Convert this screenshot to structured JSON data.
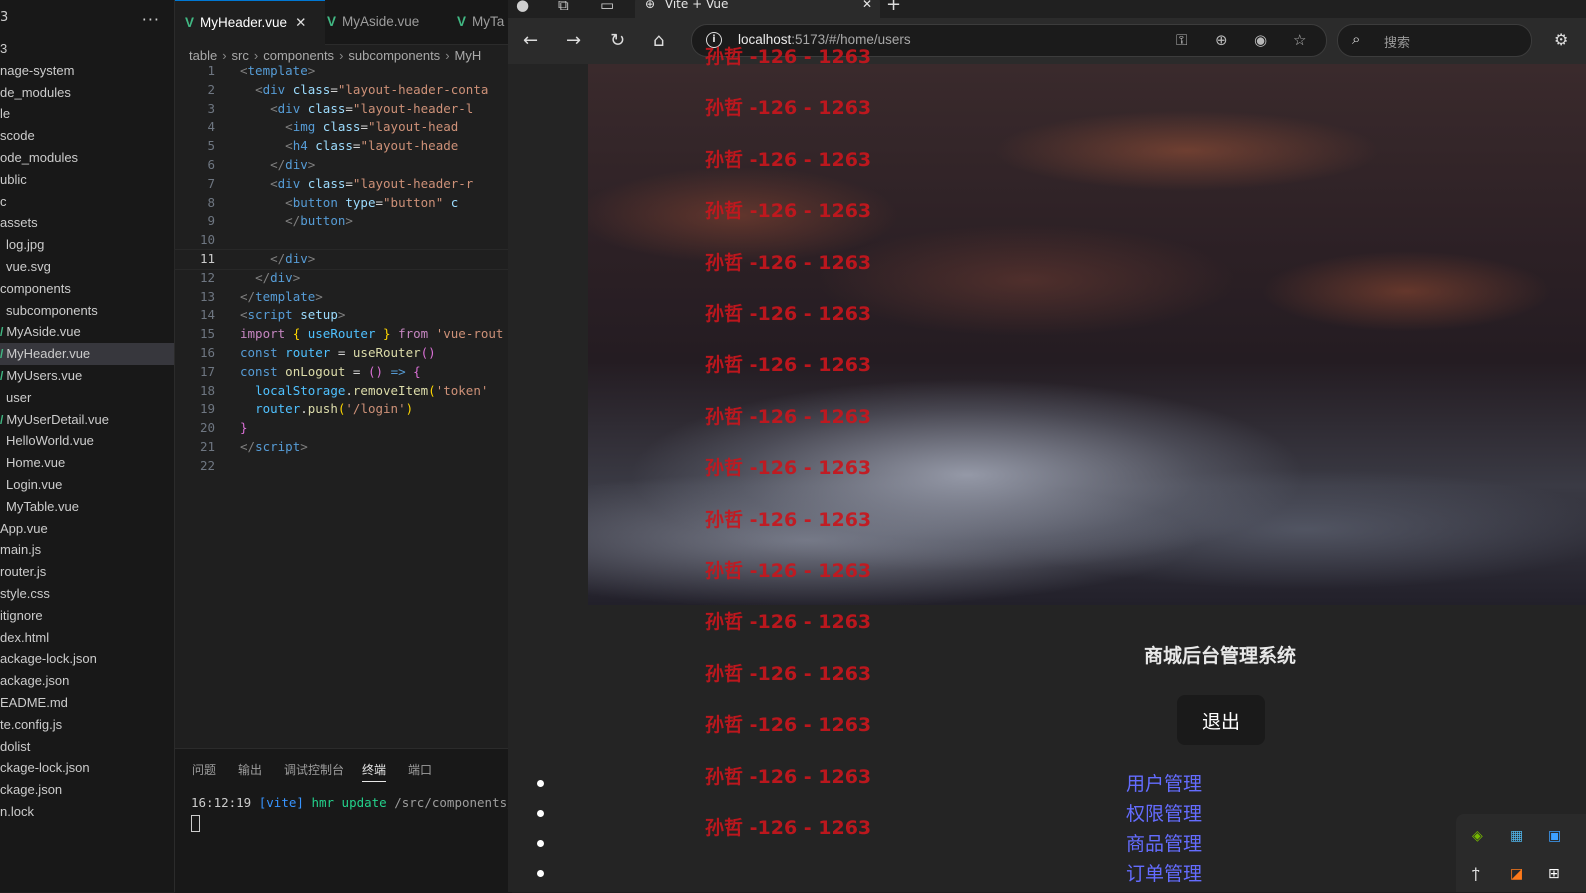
{
  "vscode": {
    "explorer": {
      "more_label": "···",
      "top_mark": "3",
      "items": [
        {
          "label": "3",
          "vue": false,
          "indent": 0
        },
        {
          "label": "nage-system",
          "vue": false,
          "indent": 0
        },
        {
          "label": "de_modules",
          "vue": false,
          "indent": 0
        },
        {
          "label": "le",
          "vue": false,
          "indent": 0
        },
        {
          "label": "scode",
          "vue": false,
          "indent": 0
        },
        {
          "label": "ode_modules",
          "vue": false,
          "indent": 0
        },
        {
          "label": "ublic",
          "vue": false,
          "indent": 0
        },
        {
          "label": "c",
          "vue": false,
          "indent": 0
        },
        {
          "label": "assets",
          "vue": false,
          "indent": 0
        },
        {
          "label": "log.jpg",
          "vue": false,
          "indent": 6
        },
        {
          "label": "vue.svg",
          "vue": false,
          "indent": 6
        },
        {
          "label": "components",
          "vue": false,
          "indent": 0
        },
        {
          "label": "subcomponents",
          "vue": false,
          "indent": 6
        },
        {
          "label": "MyAside.vue",
          "vue": true,
          "indent": 0
        },
        {
          "label": "MyHeader.vue",
          "vue": true,
          "indent": 0,
          "selected": true
        },
        {
          "label": "MyUsers.vue",
          "vue": true,
          "indent": 0
        },
        {
          "label": "user",
          "vue": false,
          "indent": 6
        },
        {
          "label": "MyUserDetail.vue",
          "vue": true,
          "indent": 0
        },
        {
          "label": "HelloWorld.vue",
          "vue": false,
          "indent": 6
        },
        {
          "label": "Home.vue",
          "vue": false,
          "indent": 6
        },
        {
          "label": "Login.vue",
          "vue": false,
          "indent": 6
        },
        {
          "label": "MyTable.vue",
          "vue": false,
          "indent": 6
        },
        {
          "label": "App.vue",
          "vue": false,
          "indent": 0
        },
        {
          "label": "main.js",
          "vue": false,
          "indent": 0
        },
        {
          "label": "router.js",
          "vue": false,
          "indent": 0
        },
        {
          "label": "style.css",
          "vue": false,
          "indent": 0
        },
        {
          "label": "itignore",
          "vue": false,
          "indent": 0
        },
        {
          "label": "dex.html",
          "vue": false,
          "indent": 0
        },
        {
          "label": "ackage-lock.json",
          "vue": false,
          "indent": 0
        },
        {
          "label": "ackage.json",
          "vue": false,
          "indent": 0
        },
        {
          "label": "EADME.md",
          "vue": false,
          "indent": 0
        },
        {
          "label": "te.config.js",
          "vue": false,
          "indent": 0
        },
        {
          "label": "dolist",
          "vue": false,
          "indent": 0
        },
        {
          "label": "ckage-lock.json",
          "vue": false,
          "indent": 0
        },
        {
          "label": "ckage.json",
          "vue": false,
          "indent": 0
        },
        {
          "label": "n.lock",
          "vue": false,
          "indent": 0
        }
      ]
    },
    "tabs": [
      {
        "label": "MyHeader.vue",
        "active": true,
        "close": "✕"
      },
      {
        "label": "MyAside.vue",
        "active": false
      },
      {
        "label": "MyTa",
        "active": false
      }
    ],
    "breadcrumb": [
      "table",
      "src",
      "components",
      "subcomponents",
      "MyH"
    ],
    "code_lines": [
      [
        [
          "tg",
          "<"
        ],
        [
          "tn",
          "template"
        ],
        [
          "tg",
          ">"
        ]
      ],
      [
        [
          "pl",
          "  "
        ],
        [
          "tg",
          "<"
        ],
        [
          "tn",
          "div"
        ],
        [
          "pl",
          " "
        ],
        [
          "at",
          "class"
        ],
        [
          "pl",
          "="
        ],
        [
          "st",
          "\"layout-header-conta"
        ]
      ],
      [
        [
          "pl",
          "    "
        ],
        [
          "tg",
          "<"
        ],
        [
          "tn",
          "div"
        ],
        [
          "pl",
          " "
        ],
        [
          "at",
          "class"
        ],
        [
          "pl",
          "="
        ],
        [
          "st",
          "\"layout-header-l"
        ]
      ],
      [
        [
          "pl",
          "      "
        ],
        [
          "tg",
          "<"
        ],
        [
          "tn",
          "img"
        ],
        [
          "pl",
          " "
        ],
        [
          "at",
          "class"
        ],
        [
          "pl",
          "="
        ],
        [
          "st",
          "\"layout-head"
        ]
      ],
      [
        [
          "pl",
          "      "
        ],
        [
          "tg",
          "<"
        ],
        [
          "tn",
          "h4"
        ],
        [
          "pl",
          " "
        ],
        [
          "at",
          "class"
        ],
        [
          "pl",
          "="
        ],
        [
          "st",
          "\"layout-heade"
        ]
      ],
      [
        [
          "pl",
          "    "
        ],
        [
          "tg",
          "</"
        ],
        [
          "tn",
          "div"
        ],
        [
          "tg",
          ">"
        ]
      ],
      [
        [
          "pl",
          "    "
        ],
        [
          "tg",
          "<"
        ],
        [
          "tn",
          "div"
        ],
        [
          "pl",
          " "
        ],
        [
          "at",
          "class"
        ],
        [
          "pl",
          "="
        ],
        [
          "st",
          "\"layout-header-r"
        ]
      ],
      [
        [
          "pl",
          "      "
        ],
        [
          "tg",
          "<"
        ],
        [
          "tn",
          "button"
        ],
        [
          "pl",
          " "
        ],
        [
          "at",
          "type"
        ],
        [
          "pl",
          "="
        ],
        [
          "st",
          "\"button\""
        ],
        [
          "pl",
          " "
        ],
        [
          "at",
          "c"
        ]
      ],
      [
        [
          "pl",
          "      "
        ],
        [
          "tg",
          "</"
        ],
        [
          "tn",
          "button"
        ],
        [
          "tg",
          ">"
        ]
      ],
      [
        [
          "pl",
          ""
        ]
      ],
      [
        [
          "pl",
          "    "
        ],
        [
          "tg",
          "</"
        ],
        [
          "tn",
          "div"
        ],
        [
          "tg",
          ">"
        ]
      ],
      [
        [
          "pl",
          "  "
        ],
        [
          "tg",
          "</"
        ],
        [
          "tn",
          "div"
        ],
        [
          "tg",
          ">"
        ]
      ],
      [
        [
          "tg",
          "</"
        ],
        [
          "tn",
          "template"
        ],
        [
          "tg",
          ">"
        ]
      ],
      [
        [
          "tg",
          "<"
        ],
        [
          "tn",
          "script"
        ],
        [
          "pl",
          " "
        ],
        [
          "at",
          "setup"
        ],
        [
          "tg",
          ">"
        ]
      ],
      [
        [
          "kw",
          "import"
        ],
        [
          "pl",
          " "
        ],
        [
          "br",
          "{"
        ],
        [
          "pl",
          " "
        ],
        [
          "vr",
          "useRouter"
        ],
        [
          "pl",
          " "
        ],
        [
          "br",
          "}"
        ],
        [
          "pl",
          " "
        ],
        [
          "kw",
          "from"
        ],
        [
          "pl",
          " "
        ],
        [
          "st",
          "'vue-rout"
        ]
      ],
      [
        [
          "tn",
          "const"
        ],
        [
          "pl",
          " "
        ],
        [
          "vr",
          "router"
        ],
        [
          "pl",
          " = "
        ],
        [
          "fn",
          "useRouter"
        ],
        [
          "bp",
          "()"
        ]
      ],
      [
        [
          "tn",
          "const"
        ],
        [
          "pl",
          " "
        ],
        [
          "fn",
          "onLogout"
        ],
        [
          "pl",
          " = "
        ],
        [
          "bp",
          "()"
        ],
        [
          "pl",
          " "
        ],
        [
          "tn",
          "=>"
        ],
        [
          "pl",
          " "
        ],
        [
          "bp",
          "{"
        ]
      ],
      [
        [
          "pl",
          "  "
        ],
        [
          "vr",
          "localStorage"
        ],
        [
          "pl",
          "."
        ],
        [
          "fn",
          "removeItem"
        ],
        [
          "br",
          "("
        ],
        [
          "st",
          "'token'"
        ]
      ],
      [
        [
          "pl",
          "  "
        ],
        [
          "vr",
          "router"
        ],
        [
          "pl",
          "."
        ],
        [
          "fn",
          "push"
        ],
        [
          "br",
          "("
        ],
        [
          "st",
          "'/login'"
        ],
        [
          "br",
          ")"
        ]
      ],
      [
        [
          "bp",
          "}"
        ]
      ],
      [
        [
          "tg",
          "</"
        ],
        [
          "tn",
          "script"
        ],
        [
          "tg",
          ">"
        ]
      ],
      [
        [
          "pl",
          ""
        ]
      ]
    ],
    "current_line": 11,
    "panel": {
      "tabs": [
        {
          "label": "问题",
          "active": false
        },
        {
          "label": "输出",
          "active": false
        },
        {
          "label": "调试控制台",
          "active": false
        },
        {
          "label": "终端",
          "active": true
        },
        {
          "label": "端口",
          "active": false
        }
      ],
      "terminal": {
        "time": "16:12:19",
        "tag": "[vite]",
        "event": "hmr update",
        "path": "/src/components/su"
      }
    }
  },
  "browser": {
    "tab_title": "Vite + Vue",
    "tab_close": "✕",
    "new_tab": "+",
    "url_host": "localhost",
    "url_rest": ":5173/#/home/users",
    "search_placeholder": "搜索",
    "page": {
      "system_title": "商城后台管理系统",
      "logout_label": "退出",
      "menu": [
        "用户管理",
        "权限管理",
        "商品管理",
        "订单管理"
      ],
      "watermark": "孙哲 -126 - 1263",
      "watermark_count": 16
    }
  },
  "colors": {
    "link": "#646cff",
    "watermark": "#c8161d",
    "vue_green": "#41b883"
  }
}
